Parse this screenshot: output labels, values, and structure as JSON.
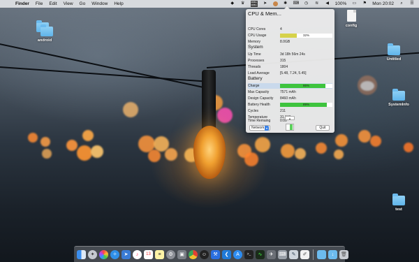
{
  "menubar": {
    "app_name": "Finder",
    "menus": [
      "File",
      "Edit",
      "View",
      "Go",
      "Window",
      "Help"
    ],
    "network_up": "0KB/s",
    "network_down": "0KB/s",
    "battery": "100%",
    "clock": "Mon 20:02"
  },
  "desktop_icons": {
    "android": "android",
    "config": "config",
    "untitled": "Untitled",
    "systeminfo": "SystemInfo",
    "test": "test"
  },
  "popover": {
    "title": "CPU & Mem...",
    "cpu": {
      "cores_label": "CPU Cores",
      "cores_value": "4",
      "usage_label": "CPU Usage",
      "usage_text": "32%",
      "usage_fraction": 0.32,
      "memory_label": "Memory",
      "memory_value": "8.0GB"
    },
    "system_header": "System",
    "system": {
      "uptime_label": "Up Time",
      "uptime_value": "3d 18h 56m 24s",
      "processes_label": "Processes",
      "processes_value": "315",
      "threads_label": "Threads",
      "threads_value": "1804",
      "load_label": "Load Average",
      "load_value": "[5.48, 7.24, 5.45]"
    },
    "battery_header": "Battery",
    "battery": {
      "charge_label": "Charge",
      "charge_text": "86%",
      "charge_fraction": 0.86,
      "max_label": "Max Capacity",
      "max_value": "7571 mAh",
      "design_label": "Design Capacity",
      "design_value": "8460 mAh",
      "health_label": "Battery Health",
      "health_text": "89%",
      "health_fraction": 0.89,
      "cycles_label": "Cycles",
      "cycles_value": "211",
      "temp_label": "Temperature",
      "temp_value": "31.0°C",
      "remaining_label": "Time Remaing",
      "remaining_value": "0:00"
    },
    "mini_button": "▴",
    "network_select": "Network",
    "quit_label": "Quit"
  },
  "colors": {
    "cpu_bar": "#d6d24a",
    "battery_bar": "#3ec43e"
  }
}
